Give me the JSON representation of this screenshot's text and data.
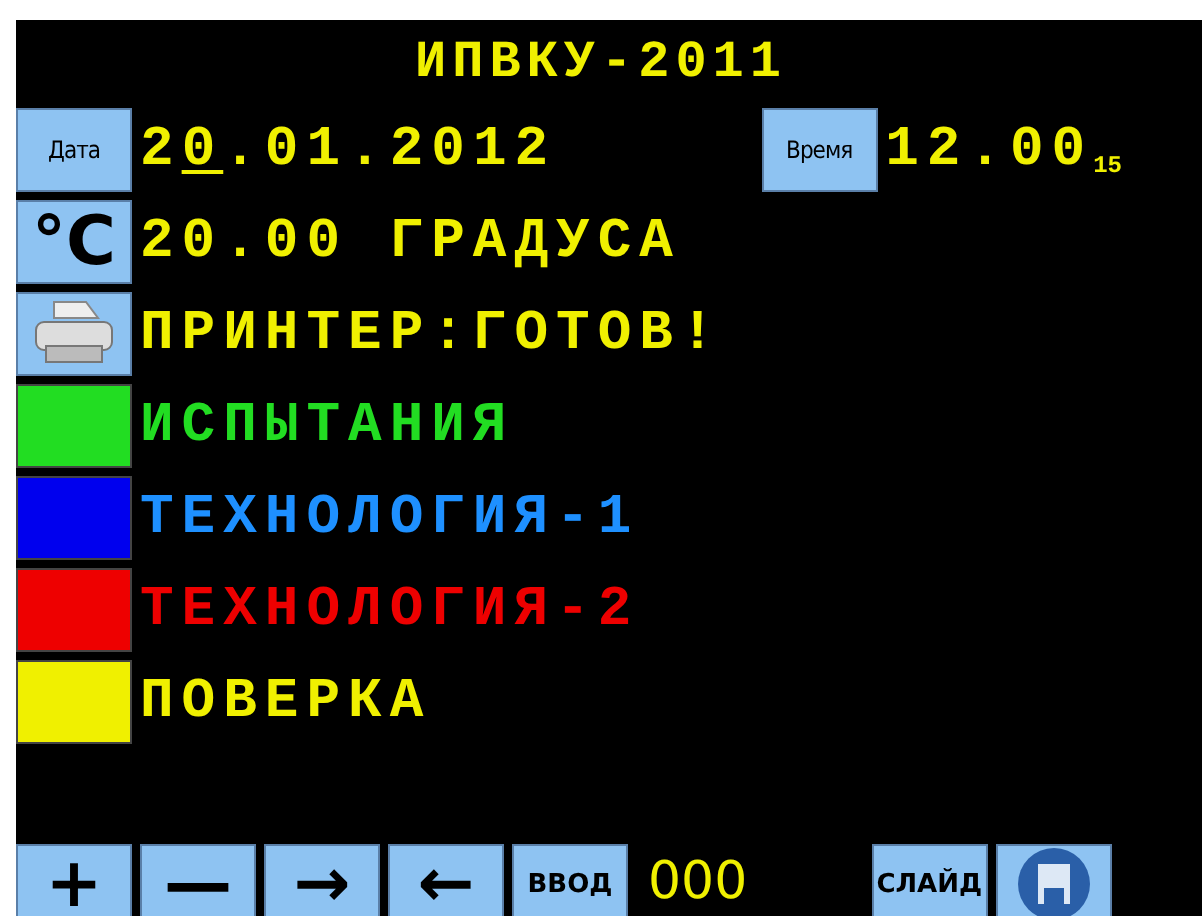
{
  "title": "ИПВКУ-2011",
  "date": {
    "label": "Дата",
    "parts": [
      {
        "text": "2",
        "cursor": false
      },
      {
        "text": "0",
        "cursor": true
      },
      {
        "text": ".01.2012",
        "cursor": false
      }
    ]
  },
  "time": {
    "label": "Время",
    "value": "12.00$_{15}$"
  },
  "temperature": {
    "unit": "°C",
    "value": "20.00 ГРАДУСА"
  },
  "printer": {
    "status": "ПРИНТЕР:ГОТОВ!"
  },
  "modes": [
    {
      "label": "ИСПЫТАНИЯ",
      "color": "#22dd22"
    },
    {
      "label": "ТЕХНОЛОГИЯ-1",
      "color": "#0000ee"
    },
    {
      "label": "ТЕХНОЛОГИЯ-2",
      "color": "#ee0000"
    },
    {
      "label": "ПОВЕРКА",
      "color": "#f0f000"
    }
  ],
  "toolbar": [
    {
      "kind": "glyph",
      "text": "+"
    },
    {
      "kind": "glyph",
      "text": "—"
    },
    {
      "kind": "glyph",
      "text": "→"
    },
    {
      "kind": "glyph",
      "text": "←"
    },
    {
      "kind": "label",
      "text": "ВВОД"
    },
    {
      "kind": "readout",
      "text": "000"
    },
    {
      "kind": "spacer"
    },
    {
      "kind": "label",
      "text": "СЛАЙД"
    },
    {
      "kind": "disk"
    }
  ]
}
